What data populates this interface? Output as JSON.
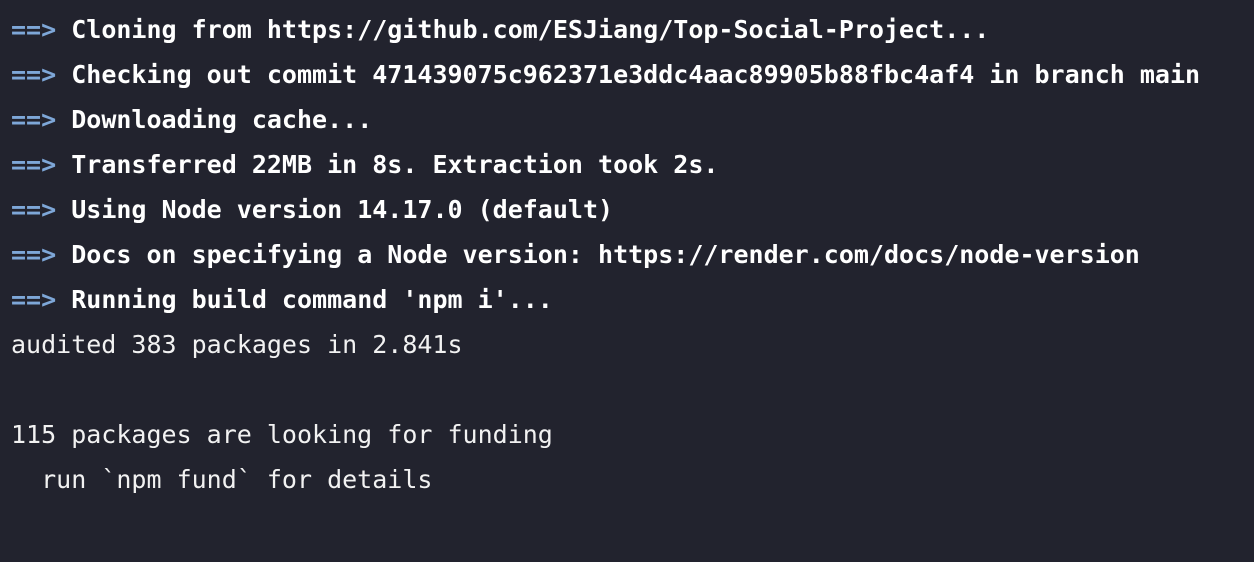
{
  "terminal": {
    "prompt_arrow": "==>",
    "colors": {
      "background": "#22232e",
      "arrow": "#7ea7d8",
      "text": "#ffffff"
    },
    "build_steps": [
      "Cloning from https://github.com/ESJiang/Top-Social-Project...",
      "Checking out commit 471439075c962371e3ddc4aac89905b88fbc4af4 in branch main",
      "Downloading cache...",
      "Transferred 22MB in 8s. Extraction took 2s.",
      "Using Node version 14.17.0 (default)",
      "Docs on specifying a Node version: https://render.com/docs/node-version",
      "Running build command 'npm i'..."
    ],
    "output_lines": [
      "audited 383 packages in 2.841s",
      "",
      "115 packages are looking for funding",
      "  run `npm fund` for details"
    ]
  }
}
